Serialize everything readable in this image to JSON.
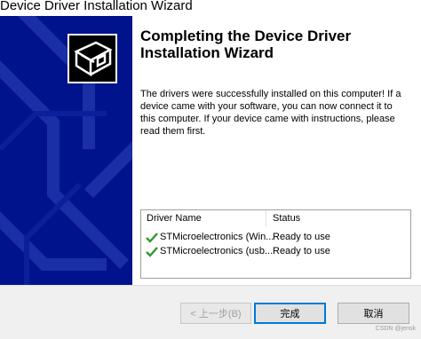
{
  "window": {
    "title": "Device Driver Installation Wizard"
  },
  "content": {
    "heading": "Completing the Device Driver\nInstallation Wizard",
    "message": "The drivers were successfully installed on this computer! If a device came with your software, you can now connect it to this computer. If your device came with instructions, please read them first."
  },
  "driver_table": {
    "headers": [
      "Driver Name",
      "Status"
    ],
    "rows": [
      {
        "name": "STMicroelectronics (Win...",
        "status": "Ready to use"
      },
      {
        "name": "STMicroelectronics (usb...",
        "status": "Ready to use"
      }
    ]
  },
  "buttons": {
    "back": "< 上一步(B)",
    "finish": "完成",
    "cancel": "取消"
  },
  "watermark": "CSDN @jensk",
  "colors": {
    "sidebar": "#00138c",
    "check": "#2e9a2e",
    "primary_border": "#0078d7"
  },
  "icons": {
    "wizard_logo": "driver-box-icon",
    "row_status": "checkmark-icon"
  }
}
